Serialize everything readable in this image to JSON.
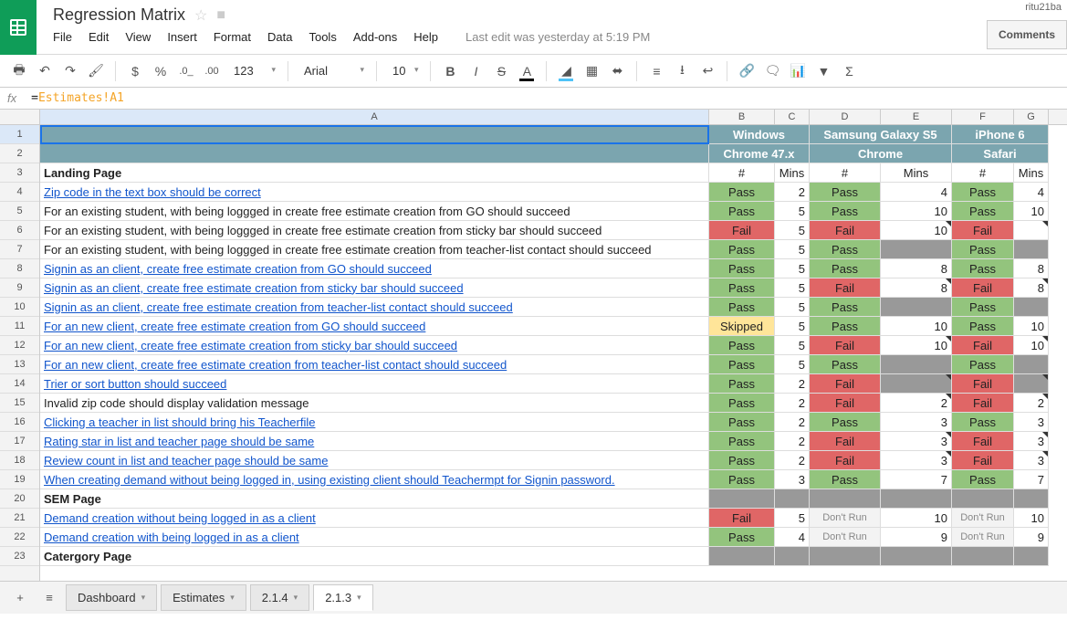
{
  "user_badge": "ritu21ba",
  "doc": {
    "title": "Regression Matrix",
    "last_edit": "Last edit was yesterday at 5:19 PM"
  },
  "menu": [
    "File",
    "Edit",
    "View",
    "Insert",
    "Format",
    "Data",
    "Tools",
    "Add-ons",
    "Help"
  ],
  "comments_btn": "Comments",
  "toolbar": {
    "font": "Arial",
    "size": "10",
    "num_fmt": "123"
  },
  "formula": {
    "eq": "=",
    "ref": "Estimates!A1"
  },
  "cols": [
    "A",
    "B",
    "C",
    "D",
    "E",
    "F",
    "G"
  ],
  "header1": {
    "b": "Windows",
    "d": "Samsung Galaxy S5",
    "f": "iPhone 6"
  },
  "header2": {
    "b": "Chrome 47.x",
    "d": "Chrome",
    "f": "Safari"
  },
  "header3": {
    "hash": "#",
    "mins": "Mins"
  },
  "sections": {
    "landing": "Landing Page",
    "sem": "SEM Page",
    "category": "Catergory Page"
  },
  "status": {
    "pass": "Pass",
    "fail": "Fail",
    "skipped": "Skipped",
    "dontrun": "Don't Run"
  },
  "rows": [
    {
      "n": 4,
      "text": "Zip code in the text box should be correct",
      "link": true,
      "b": "pass",
      "c": "2",
      "d": "pass",
      "e": "4",
      "f": "pass",
      "g": "4"
    },
    {
      "n": 5,
      "text": "For an existing student, with being loggged in create free estimate creation from GO should succeed",
      "link": false,
      "b": "pass",
      "c": "5",
      "d": "pass",
      "e": "10",
      "f": "pass",
      "g": "10"
    },
    {
      "n": 6,
      "text": "For an existing student, with being loggged in create free estimate creation from sticky bar should succeed",
      "link": false,
      "b": "fail",
      "c": "5",
      "d": "fail",
      "e": "10",
      "emark": true,
      "f": "fail",
      "g": "",
      "gmark": true
    },
    {
      "n": 7,
      "text": "For an existing student, with being loggged in create free estimate creation from teacher-list contact should succeed",
      "link": false,
      "b": "pass",
      "c": "5",
      "d": "pass",
      "e": "",
      "ecls": "gray",
      "f": "pass",
      "g": "",
      "gcls": "gray"
    },
    {
      "n": 8,
      "text": "Signin as an client, create free estimate creation from GO should succeed",
      "link": true,
      "b": "pass",
      "c": "5",
      "d": "pass",
      "e": "8",
      "f": "pass",
      "g": "8"
    },
    {
      "n": 9,
      "text": "Signin as an client, create free estimate creation from sticky bar should succeed",
      "link": true,
      "b": "pass",
      "c": "5",
      "d": "fail",
      "e": "8",
      "emark": true,
      "f": "fail",
      "g": "8",
      "gmark": true
    },
    {
      "n": 10,
      "text": "Signin as an client, create free estimate creation from teacher-list contact should succeed",
      "link": true,
      "b": "pass",
      "c": "5",
      "d": "pass",
      "e": "",
      "ecls": "gray",
      "f": "pass",
      "g": "",
      "gcls": "gray"
    },
    {
      "n": 11,
      "text": "For an new  client, create free estimate creation from GO should succeed",
      "link": true,
      "b": "skipped",
      "c": "5",
      "d": "pass",
      "e": "10",
      "f": "pass",
      "g": "10"
    },
    {
      "n": 12,
      "text": "For an new  client, create free estimate creation from sticky bar should succeed",
      "link": true,
      "b": "pass",
      "c": "5",
      "d": "fail",
      "e": "10",
      "emark": true,
      "f": "fail",
      "g": "10",
      "gmark": true
    },
    {
      "n": 13,
      "text": "For an new  client, create free estimate creation from teacher-list contact should succeed",
      "link": true,
      "b": "pass",
      "c": "5",
      "d": "pass",
      "e": "",
      "ecls": "gray",
      "f": "pass",
      "g": "",
      "gcls": "gray"
    },
    {
      "n": 14,
      "text": "Trier or sort button should succeed",
      "link": true,
      "b": "pass",
      "c": "2",
      "d": "fail",
      "e": "",
      "ecls": "gray",
      "emark": true,
      "f": "fail",
      "g": "",
      "gcls": "gray",
      "gmark": true
    },
    {
      "n": 15,
      "text": "Invalid zip code should display validation message",
      "link": false,
      "b": "pass",
      "c": "2",
      "d": "fail",
      "e": "2",
      "emark": true,
      "f": "fail",
      "g": "2",
      "gmark": true
    },
    {
      "n": 16,
      "text": "Clicking a teacher in list should bring his Teacherfile",
      "link": true,
      "b": "pass",
      "c": "2",
      "d": "pass",
      "e": "3",
      "f": "pass",
      "g": "3"
    },
    {
      "n": 17,
      "text": "Rating star in list and teacher page should be same",
      "link": true,
      "b": "pass",
      "c": "2",
      "d": "fail",
      "e": "3",
      "emark": true,
      "f": "fail",
      "g": "3",
      "gmark": true
    },
    {
      "n": 18,
      "text": "Review count in list and teacher page should be same",
      "link": true,
      "b": "pass",
      "c": "2",
      "d": "fail",
      "e": "3",
      "emark": true,
      "f": "fail",
      "g": "3",
      "gmark": true
    },
    {
      "n": 19,
      "text": "When creating demand without being logged in, using existing client should Teachermpt for Signin password.",
      "link": true,
      "b": "pass",
      "c": "3",
      "d": "pass",
      "e": "7",
      "f": "pass",
      "g": "7"
    }
  ],
  "sem_rows": [
    {
      "n": 21,
      "text": "Demand creation without being logged in as a client",
      "link": true,
      "b": "fail",
      "c": "5",
      "d": "dontrun",
      "e": "10",
      "f": "dontrun",
      "g": "10"
    },
    {
      "n": 22,
      "text": "Demand creation with being logged in as a client",
      "link": true,
      "b": "pass",
      "c": "4",
      "d": "dontrun",
      "e": "9",
      "f": "dontrun",
      "g": "9"
    }
  ],
  "sheets": [
    "Dashboard",
    "Estimates",
    "2.1.4",
    "2.1.3"
  ]
}
